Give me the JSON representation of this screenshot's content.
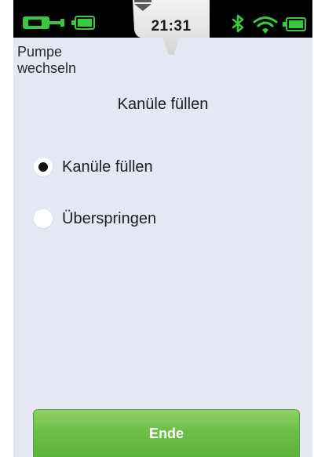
{
  "status_bar": {
    "time": "21:31",
    "left_icons": [
      "pump-icon",
      "battery-icon"
    ],
    "right_icons": [
      "bluetooth-icon",
      "wifi-icon",
      "battery-icon"
    ],
    "indicator_color": "#39c93c"
  },
  "header": {
    "back_label": "Pumpe\nwechseln"
  },
  "main": {
    "title": "Kanüle füllen",
    "options": [
      {
        "label": "Kanüle füllen",
        "selected": true
      },
      {
        "label": "Überspringen",
        "selected": false
      }
    ]
  },
  "footer": {
    "end_label": "Ende",
    "end_color": "#6cbf46"
  },
  "colors": {
    "background": "#e5e7f3",
    "status_bar": "#000000"
  }
}
